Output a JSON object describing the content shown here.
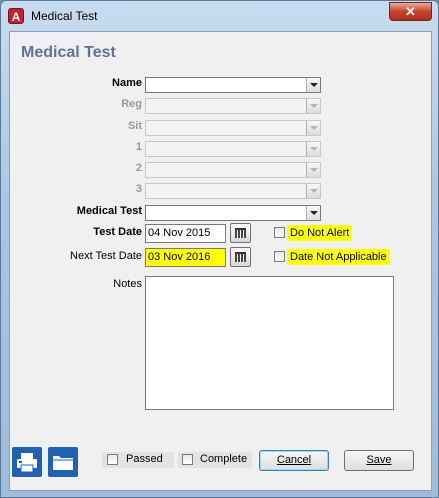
{
  "window": {
    "title": "Medical Test",
    "app_icon_letter": "A",
    "close_glyph": "✕"
  },
  "form": {
    "heading": "Medical Test",
    "fields": {
      "name": {
        "label": "Name",
        "value": ""
      },
      "reg": {
        "label": "Reg",
        "value": ""
      },
      "sit": {
        "label": "Sit",
        "value": ""
      },
      "f1": {
        "label": "1",
        "value": ""
      },
      "f2": {
        "label": "2",
        "value": ""
      },
      "f3": {
        "label": "3",
        "value": ""
      },
      "medical_test": {
        "label": "Medical Test",
        "value": ""
      },
      "test_date": {
        "label": "Test Date",
        "value": "04 Nov 2015"
      },
      "next_test_date": {
        "label": "Next Test Date",
        "value": "03 Nov 2016"
      },
      "notes": {
        "label": "Notes",
        "value": ""
      }
    },
    "checkboxes": {
      "do_not_alert": {
        "label": "Do Not Alert",
        "checked": false
      },
      "date_not_applicable": {
        "label": "Date Not Applicable",
        "checked": false
      },
      "passed": {
        "label": "Passed",
        "checked": false
      },
      "complete": {
        "label": "Complete",
        "checked": false
      }
    }
  },
  "footer": {
    "print_icon": "printer-icon",
    "folder_icon": "folder-icon",
    "cancel_label": "Cancel",
    "save_label": "Save"
  },
  "colors": {
    "heading": "#5a7497",
    "highlight": "#ffff00",
    "icon_button": "#1f62b4"
  }
}
